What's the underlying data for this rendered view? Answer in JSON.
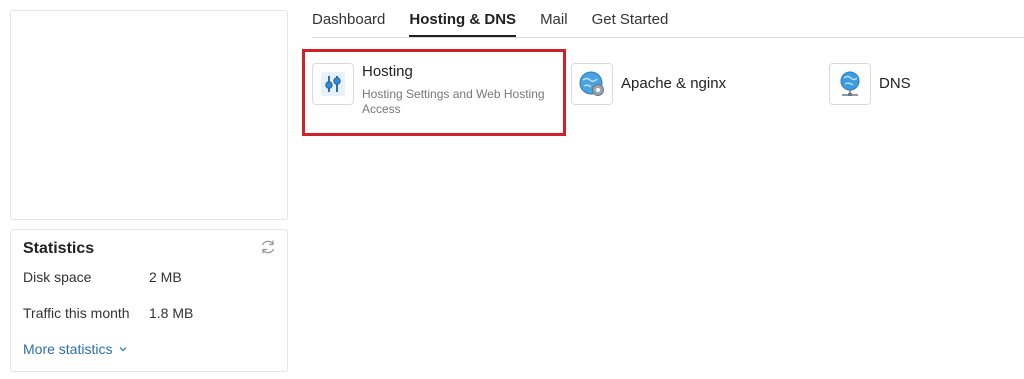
{
  "tabs": [
    {
      "label": "Dashboard"
    },
    {
      "label": "Hosting & DNS",
      "active": true
    },
    {
      "label": "Mail"
    },
    {
      "label": "Get Started"
    }
  ],
  "tiles": {
    "hosting": {
      "title": "Hosting",
      "description": "Hosting Settings and Web Hosting Access",
      "icon": "sliders-icon"
    },
    "apache": {
      "title": "Apache & nginx",
      "icon": "globe-gear-icon"
    },
    "dns": {
      "title": "DNS",
      "icon": "globe-network-icon"
    }
  },
  "statistics": {
    "title": "Statistics",
    "rows": [
      {
        "label": "Disk space",
        "value": "2 MB"
      },
      {
        "label": "Traffic this month",
        "value": "1.8 MB"
      }
    ],
    "more_label": "More statistics"
  },
  "colors": {
    "highlight": "#d0202a",
    "link": "#2b6fa6",
    "icon_blue": "#2f8fd8"
  }
}
